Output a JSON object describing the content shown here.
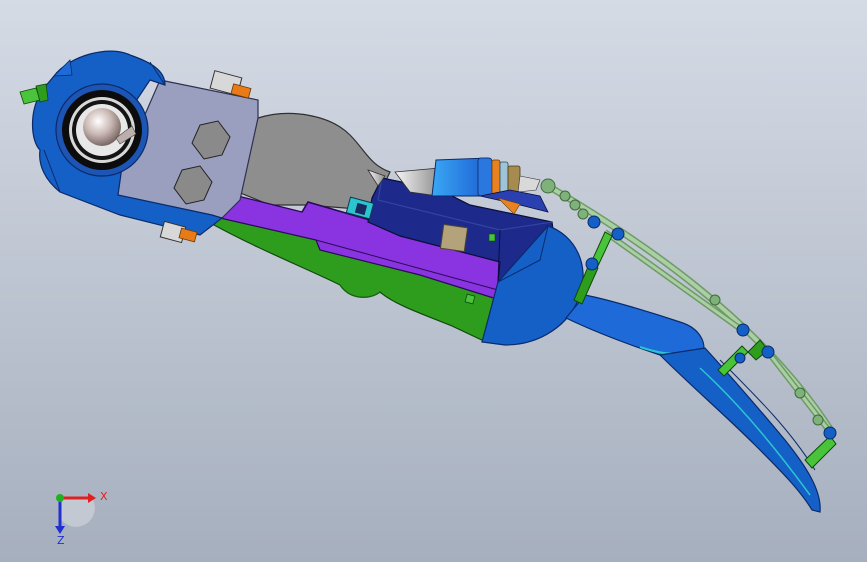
{
  "triad": {
    "x_label": "X",
    "z_label": "Z"
  },
  "colors": {
    "background_top": "#d2d8e3",
    "background_bottom": "#a7b0bf",
    "housing_blue": "#1560c7",
    "grey_plate": "#9a9fc0",
    "purple_rail": "#8a33e0",
    "green_body": "#2e9d1e",
    "dark_navy": "#1d2a8c",
    "tendon_green": "#8fb48a",
    "axis_x": "#e02020",
    "axis_y": "#20b020",
    "axis_z": "#2030d0"
  }
}
